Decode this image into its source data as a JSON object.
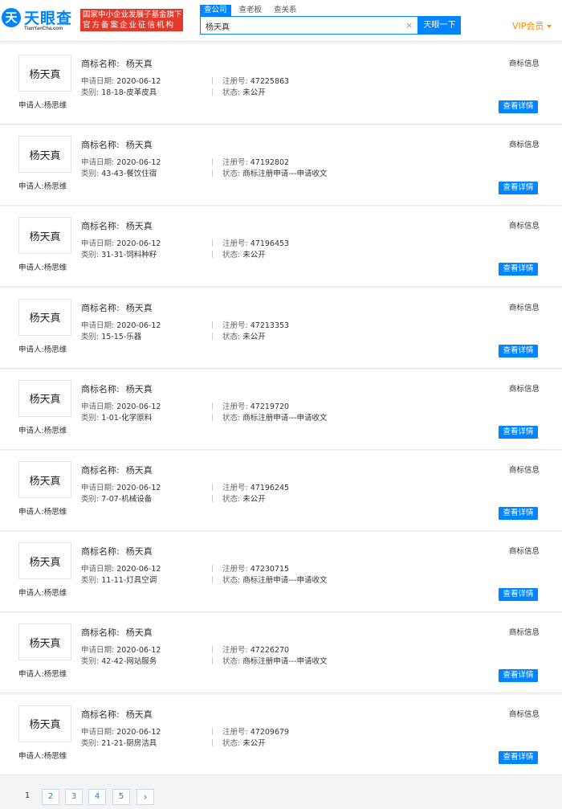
{
  "header": {
    "logo_mark": "天",
    "logo_text": "天眼查",
    "logo_sub": "TianYanCha.com",
    "badge_line1": "国家中小企业发展子基金旗下",
    "badge_line2": "官方备案企业征信机构",
    "tabs": [
      {
        "label": "查公司",
        "active": true
      },
      {
        "label": "查老板",
        "active": false
      },
      {
        "label": "查关系",
        "active": false
      }
    ],
    "search_value": "杨天真",
    "clear_icon": "×",
    "search_button": "天眼一下",
    "vip_label": "VIP会员"
  },
  "labels": {
    "name": "商标名称:",
    "date": "申请日期:",
    "class": "类别:",
    "regno": "注册号:",
    "status": "状态:",
    "applicant": "申请人:",
    "info_tag": "商标信息",
    "detail_button": "查看详情"
  },
  "records": [
    {
      "mark": "杨天真",
      "name": "杨天真",
      "date": "2020-06-12",
      "class": "18-18-皮革皮具",
      "regno": "47225863",
      "status": "未公开",
      "applicant": "杨思维"
    },
    {
      "mark": "杨天真",
      "name": "杨天真",
      "date": "2020-06-12",
      "class": "43-43-餐饮住宿",
      "regno": "47192802",
      "status": "商标注册申请---申请收文",
      "applicant": "杨思维"
    },
    {
      "mark": "杨天真",
      "name": "杨天真",
      "date": "2020-06-12",
      "class": "31-31-饲料种籽",
      "regno": "47196453",
      "status": "未公开",
      "applicant": "杨思维"
    },
    {
      "mark": "杨天真",
      "name": "杨天真",
      "date": "2020-06-12",
      "class": "15-15-乐器",
      "regno": "47213353",
      "status": "未公开",
      "applicant": "杨思维"
    },
    {
      "mark": "杨天真",
      "name": "杨天真",
      "date": "2020-06-12",
      "class": "1-01-化学原料",
      "regno": "47219720",
      "status": "商标注册申请---申请收文",
      "applicant": "杨思维"
    },
    {
      "mark": "杨天真",
      "name": "杨天真",
      "date": "2020-06-12",
      "class": "7-07-机械设备",
      "regno": "47196245",
      "status": "未公开",
      "applicant": "杨思维"
    },
    {
      "mark": "杨天真",
      "name": "杨天真",
      "date": "2020-06-12",
      "class": "11-11-灯具空调",
      "regno": "47230715",
      "status": "商标注册申请---申请收文",
      "applicant": "杨思维"
    },
    {
      "mark": "杨天真",
      "name": "杨天真",
      "date": "2020-06-12",
      "class": "42-42-网站服务",
      "regno": "47226270",
      "status": "商标注册申请---申请收文",
      "applicant": "杨思维"
    },
    {
      "mark": "杨天真",
      "name": "杨天真",
      "date": "2020-06-12",
      "class": "21-21-厨房洁具",
      "regno": "47209679",
      "status": "未公开",
      "applicant": "杨思维"
    }
  ],
  "pagination": {
    "pages": [
      "1",
      "2",
      "3",
      "4",
      "5"
    ],
    "current": "1",
    "next_icon": "›"
  }
}
